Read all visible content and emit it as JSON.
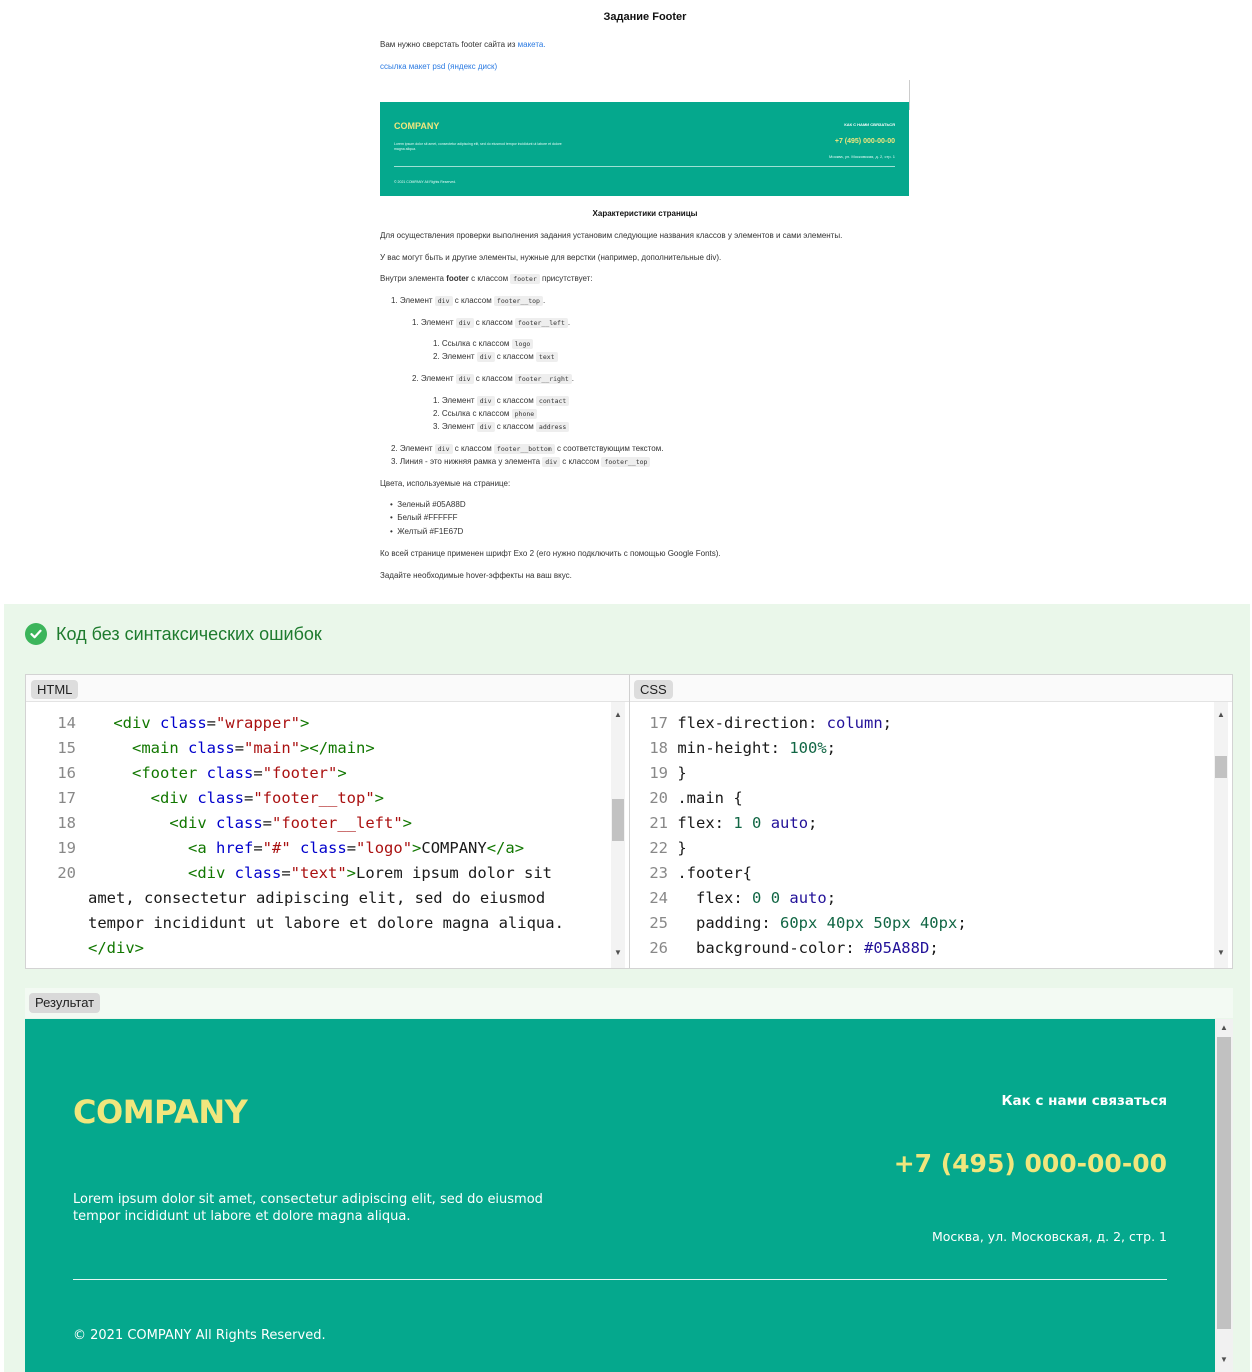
{
  "task": {
    "title": "Задание Footer",
    "intro_prefix": "Вам нужно сверстать footer сайта из ",
    "intro_link": "макета.",
    "psd_link": "ссылка макет psd (яндекс диск)",
    "mockup": {
      "logo": "COMPANY",
      "text": "Lorem ipsum dolor sit amet, consectetur adipiscing elit, sed do eiusmod tempor incididunt ut labore et dolore magna aliqua.",
      "contact": "КАК С НАМИ СВЯЗАТЬСЯ",
      "phone": "+7 (495) 000-00-00",
      "address": "Москва, ул. Московская, д. 2, стр. 1",
      "copyright": "© 2021 COMPANY All Rights Reserved."
    },
    "characteristics_title": "Характеристики страницы",
    "para1": "Для осуществления проверки выполнения задания установим следующие названия классов у элементов и сами элементы.",
    "para2": "У вас могут быть и другие элементы, нужные для верстки (например, дополнительные div).",
    "inside_prefix": "Внутри элемента ",
    "inside_bold": "footer",
    "with_class": " с классом ",
    "inside_code": "footer",
    "inside_suffix": " присутствует:",
    "list": {
      "i1_pre": "1. Элемент ",
      "i1_tag": "div",
      "i1_mid": " с классом ",
      "i1_cls": "footer__top",
      "i1_end": ".",
      "i1a_pre": "1. Элемент ",
      "i1a_tag": "div",
      "i1a_mid": " с классом ",
      "i1a_cls": "footer__left",
      "i1a_end": ".",
      "i1a1_pre": "1. Ссылка с классом ",
      "i1a1_cls": "logo",
      "i1a2_pre": "2. Элемент ",
      "i1a2_tag": "div",
      "i1a2_mid": " с классом ",
      "i1a2_cls": "text",
      "i1b_pre": "2. Элемент ",
      "i1b_tag": "div",
      "i1b_mid": " с классом ",
      "i1b_cls": "footer__right",
      "i1b_end": ".",
      "i1b1_pre": "1. Элемент ",
      "i1b1_tag": "div",
      "i1b1_mid": " с классом ",
      "i1b1_cls": "contact",
      "i1b2_pre": "2. Ссылка с классом ",
      "i1b2_cls": "phone",
      "i1b3_pre": "3. Элемент ",
      "i1b3_tag": "div",
      "i1b3_mid": " с классом ",
      "i1b3_cls": "address",
      "i2_pre": "2. Элемент ",
      "i2_tag": "div",
      "i2_mid": " с классом ",
      "i2_cls": "footer__bottom",
      "i2_end": " с соответствующим текстом.",
      "i3_pre": "3. Линия - это нижняя рамка у элемента ",
      "i3_tag": "div",
      "i3_mid": " с классом ",
      "i3_cls": "footer__top"
    },
    "colors_title": "Цвета, используемые на странице:",
    "colors": [
      "Зеленый #05A88D",
      "Белый #FFFFFF",
      "Желтый #F1E67D"
    ],
    "font_note": "Ко всей странице применен шрифт Exo 2 (его нужно подключить с помощью Google Fonts).",
    "hover_note": "Задайте необходимые hover-эффекты на ваш вкус."
  },
  "status": {
    "text": "Код без синтаксических ошибок",
    "icon": "check-circle-icon",
    "color": "#3cb55b"
  },
  "editors": {
    "html_label": "HTML",
    "css_label": "CSS",
    "html_lines": {
      "n14": "14",
      "n15": "15",
      "n16": "16",
      "n17": "17",
      "n18": "18",
      "n19": "19",
      "n20": "20",
      "l14_indent": "    ",
      "l14_tag": "<div",
      "l14_attr": "class",
      "l14_eq": "=",
      "l14_val": "\"wrapper\"",
      "l14_end": ">",
      "l15_indent": "      ",
      "l15_tag": "<main",
      "l15_attr": "class",
      "l15_eq": "=",
      "l15_val": "\"main\"",
      "l15_end": "></main>",
      "l16_indent": "      ",
      "l16_tag": "<footer",
      "l16_attr": "class",
      "l16_eq": "=",
      "l16_val": "\"footer\"",
      "l16_end": ">",
      "l17_indent": "        ",
      "l17_tag": "<div",
      "l17_attr": "class",
      "l17_eq": "=",
      "l17_val": "\"footer__top\"",
      "l17_end": ">",
      "l18_indent": "          ",
      "l18_tag": "<div",
      "l18_attr": "class",
      "l18_eq": "=",
      "l18_val": "\"footer__left\"",
      "l18_end": ">",
      "l19_indent": "            ",
      "l19_tag": "<a",
      "l19_attr1": "href",
      "l19_eq1": "=",
      "l19_val1": "\"#\"",
      "l19_attr2": "class",
      "l19_eq2": "=",
      "l19_val2": "\"logo\"",
      "l19_gt": ">",
      "l19_text": "COMPANY",
      "l19_close": "</a>",
      "l20_indent": "            ",
      "l20_tag": "<div",
      "l20_attr": "class",
      "l20_eq": "=",
      "l20_val": "\"text\"",
      "l20_gt": ">",
      "l20_text": "Lorem ipsum dolor sit",
      "l20_wrap1": "amet, consectetur adipiscing elit, sed do eiusmod",
      "l20_wrap2": "tempor incididunt ut labore et dolore magna aliqua.",
      "l20_wrap3": "</div>"
    },
    "css_lines": {
      "n17": "17",
      "n18": "18",
      "n19": "19",
      "n20": "20",
      "n21": "21",
      "n22": "22",
      "n23": "23",
      "n24": "24",
      "n25": "25",
      "n26": "26",
      "l17_prop": "flex-direction: ",
      "l17_val": "column",
      "l17_end": ";",
      "l18_prop": "min-height: ",
      "l18_val": "100%",
      "l18_end": ";",
      "l19": "}",
      "l20": ".main {",
      "l21_prop": "flex: ",
      "l21_v1": "1",
      "l21_v2": "0",
      "l21_v3": "auto",
      "l21_end": ";",
      "l22": "}",
      "l23": ".footer{",
      "l24_prop": "  flex: ",
      "l24_v1": "0",
      "l24_v2": "0",
      "l24_v3": "auto",
      "l24_end": ";",
      "l25_prop": "  padding: ",
      "l25_val": "60px 40px 50px 40px",
      "l25_end": ";",
      "l26_prop": "  background-color: ",
      "l26_val": "#05A88D",
      "l26_end": ";"
    }
  },
  "result": {
    "label": "Результат",
    "logo": "COMPANY",
    "text": "Lorem ipsum dolor sit amet, consectetur adipiscing elit, sed do eiusmod tempor incididunt ut labore et dolore magna aliqua.",
    "contact": "Как с нами связаться",
    "phone": "+7 (495) 000-00-00",
    "address": "Москва, ул. Московская, д. 2, стр. 1",
    "copyright": "© 2021 COMPANY All Rights Reserved.",
    "bg_color": "#05A88D",
    "accent_color": "#F1E67D"
  }
}
